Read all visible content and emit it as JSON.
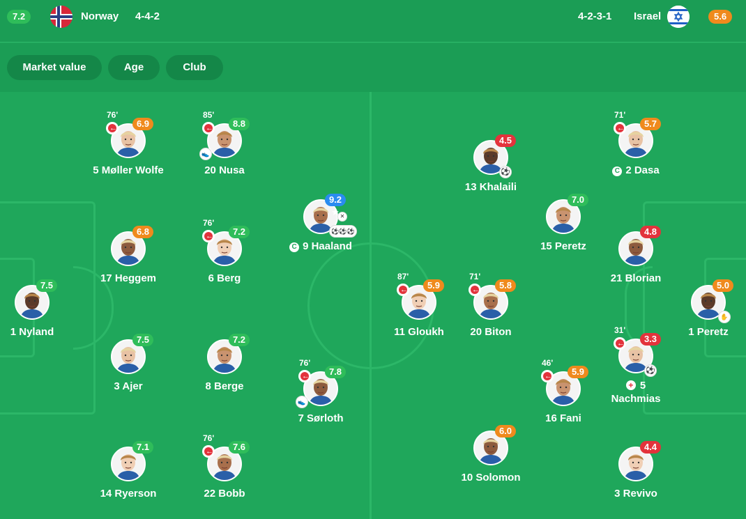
{
  "header": {
    "home": {
      "rating": "7.2",
      "rating_color": "#2fbd5a",
      "team": "Norway",
      "formation": "4-4-2"
    },
    "away": {
      "rating": "5.6",
      "rating_color": "#ef8a1d",
      "team": "Israel",
      "formation": "4-2-3-1"
    }
  },
  "filters": [
    "Market value",
    "Age",
    "Club"
  ],
  "colors": {
    "green": "#2fbd5a",
    "orange": "#ef8a1d",
    "red": "#e3333c",
    "blue": "#2a8cf0"
  },
  "players": {
    "nor_5": {
      "name": "5 Møller Wolfe",
      "rating": "6.9",
      "color": "orange",
      "sub": "76'"
    },
    "nor_20": {
      "name": "20 Nusa",
      "rating": "8.8",
      "color": "green",
      "sub": "85'",
      "event": "boot-icon"
    },
    "nor_17": {
      "name": "17 Heggem",
      "rating": "6.8",
      "color": "orange"
    },
    "nor_6": {
      "name": "6 Berg",
      "rating": "7.2",
      "color": "green",
      "sub": "76'"
    },
    "nor_9": {
      "name": "9 Haaland",
      "rating": "9.2 ★",
      "color": "blue",
      "captain": "C",
      "event": "goals-icon"
    },
    "nor_1": {
      "name": "1 Nyland",
      "rating": "7.5",
      "color": "green"
    },
    "nor_3": {
      "name": "3 Ajer",
      "rating": "7.5",
      "color": "green"
    },
    "nor_8": {
      "name": "8 Berge",
      "rating": "7.2",
      "color": "green"
    },
    "nor_7": {
      "name": "7 Sørloth",
      "rating": "7.8",
      "color": "green",
      "sub": "76'",
      "event": "boot-icon"
    },
    "nor_14": {
      "name": "14 Ryerson",
      "rating": "7.1",
      "color": "green"
    },
    "nor_22": {
      "name": "22 Bobb",
      "rating": "7.6",
      "color": "green",
      "sub": "76'"
    },
    "isr_13": {
      "name": "13 Khalaili",
      "rating": "4.5",
      "color": "red",
      "event": "own-goal-icon"
    },
    "isr_2": {
      "name": "2 Dasa",
      "rating": "5.7",
      "color": "orange",
      "sub": "71'",
      "captain": "C"
    },
    "isr_15": {
      "name": "15 Peretz",
      "rating": "7.0",
      "color": "green"
    },
    "isr_21": {
      "name": "21 Blorian",
      "rating": "4.8",
      "color": "red"
    },
    "isr_11": {
      "name": "11 Gloukh",
      "rating": "5.9",
      "color": "orange",
      "sub": "87'"
    },
    "isr_20": {
      "name": "20 Biton",
      "rating": "5.8",
      "color": "orange",
      "sub": "71'"
    },
    "isr_1": {
      "name": "1 Peretz",
      "rating": "5.0",
      "color": "orange",
      "event": "glove-icon"
    },
    "isr_5": {
      "name": "5 Nachmias",
      "rating": "3.3",
      "color": "red",
      "sub": "31'",
      "event": "own-goal-icon",
      "injury": "+"
    },
    "isr_16": {
      "name": "16 Fani",
      "rating": "5.9",
      "color": "orange",
      "sub": "46'"
    },
    "isr_10": {
      "name": "10 Solomon",
      "rating": "6.0",
      "color": "orange"
    },
    "isr_3": {
      "name": "3 Revivo",
      "rating": "4.4",
      "color": "red"
    }
  }
}
